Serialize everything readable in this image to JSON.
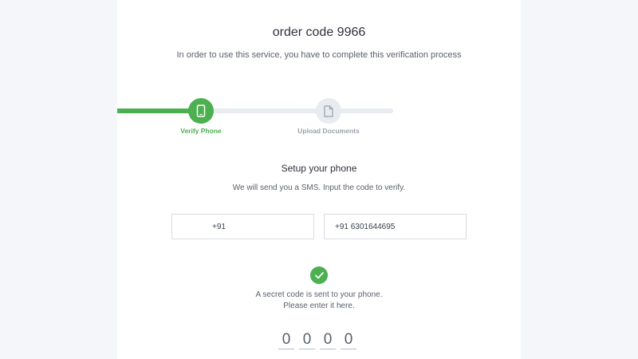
{
  "header": {
    "title": "order code 9966",
    "subtitle": "In order to use this service, you have to complete this verification process"
  },
  "progress": {
    "fraction": 0.3,
    "steps": [
      {
        "label": "Verify Phone",
        "icon": "phone-icon",
        "state": "active"
      },
      {
        "label": "Upload Documents",
        "icon": "document-icon",
        "state": "inactive"
      }
    ]
  },
  "setup": {
    "title": "Setup your phone",
    "subtitle": "We will send you a SMS. Input the code to verify."
  },
  "form": {
    "country_code": "+91",
    "phone_number": "+91 6301644695"
  },
  "confirmation": {
    "icon": "check-icon",
    "line1": "A secret code is sent to your phone.",
    "line2": "Please enter it here."
  },
  "otp": [
    "0",
    "0",
    "0",
    "0"
  ],
  "colors": {
    "accent": "#4caf50",
    "track": "#e8ebef",
    "background": "#f5f6fa"
  }
}
